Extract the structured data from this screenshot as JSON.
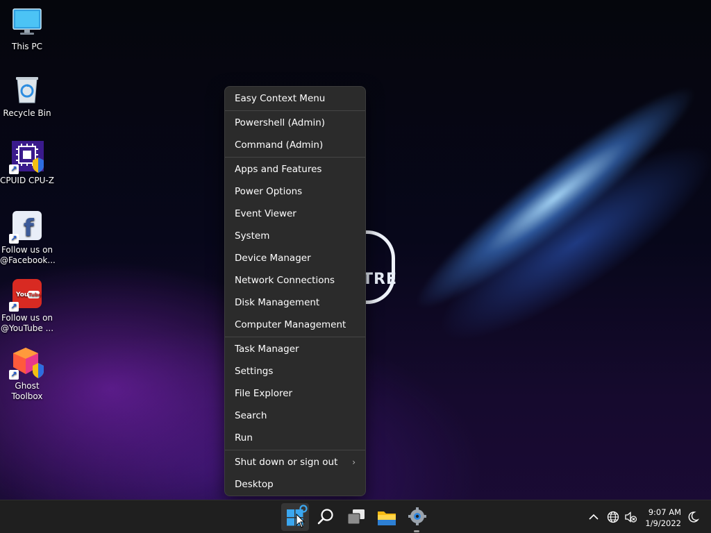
{
  "desktop": {
    "icons": [
      {
        "label_line1": "This PC",
        "label_line2": "",
        "icon": "monitor-icon"
      },
      {
        "label_line1": "Recycle Bin",
        "label_line2": "",
        "icon": "recycle-bin-icon"
      },
      {
        "label_line1": "CPUID CPU-Z",
        "label_line2": "",
        "icon": "cpu-chip-icon"
      },
      {
        "label_line1": "Follow us on",
        "label_line2": "@Facebook...",
        "icon": "facebook-icon"
      },
      {
        "label_line1": "Follow us on",
        "label_line2": "@YouTube ...",
        "icon": "youtube-icon"
      },
      {
        "label_line1": "Ghost",
        "label_line2": "Toolbox",
        "icon": "ghost-toolbox-icon"
      }
    ],
    "wallpaper_logo_text": "TRE"
  },
  "context_menu": {
    "items": [
      "Easy Context Menu",
      "Powershell (Admin)",
      "Command (Admin)",
      "Apps and Features",
      "Power Options",
      "Event Viewer",
      "System",
      "Device Manager",
      "Network Connections",
      "Disk Management",
      "Computer Management",
      "Task Manager",
      "Settings",
      "File Explorer",
      "Search",
      "Run",
      "Shut down or sign out",
      "Desktop"
    ],
    "submenu_arrow": "›"
  },
  "taskbar": {
    "buttons": [
      "start-icon",
      "search-icon",
      "task-view-icon",
      "file-explorer-icon",
      "settings-icon"
    ],
    "tray": {
      "time": "9:07 AM",
      "date": "1/9/2022",
      "icons": [
        "chevron-up-icon",
        "globe-icon",
        "speaker-muted-icon",
        "focus-moon-icon"
      ]
    }
  },
  "colors": {
    "menu_bg": "#2b2b2b",
    "taskbar_bg": "#1f1f1f",
    "accent": "#0078d4"
  }
}
